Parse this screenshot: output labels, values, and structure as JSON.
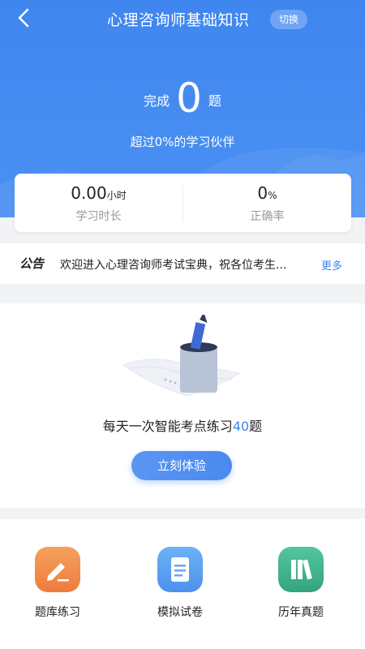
{
  "header": {
    "title": "心理咨询师基础知识",
    "switch_label": "切换"
  },
  "progress": {
    "done_prefix": "完成",
    "done_count": "0",
    "done_suffix": "题",
    "beat_text": "超过0%的学习伙伴"
  },
  "stats": {
    "study_time_value": "0.00",
    "study_time_unit": "小时",
    "study_time_label": "学习时长",
    "accuracy_value": "0",
    "accuracy_unit": "%",
    "accuracy_label": "正确率"
  },
  "notice": {
    "tag": "公告",
    "text": "欢迎进入心理咨询师考试宝典，祝各位考生...",
    "more": "更多"
  },
  "practice": {
    "text_prefix": "每天一次智能考点练习",
    "text_count": "40",
    "text_suffix": "题",
    "button_label": "立刻体验"
  },
  "menu": {
    "items": [
      {
        "label": "题库练习",
        "icon": "pencil-icon",
        "color": "#f08a47"
      },
      {
        "label": "模拟试卷",
        "icon": "test-paper-icon",
        "color": "#5aa2ef"
      },
      {
        "label": "历年真题",
        "icon": "books-icon",
        "color": "#3fb58f"
      }
    ]
  },
  "colors": {
    "primary": "#3f86ef",
    "background": "#f2f3f5"
  }
}
